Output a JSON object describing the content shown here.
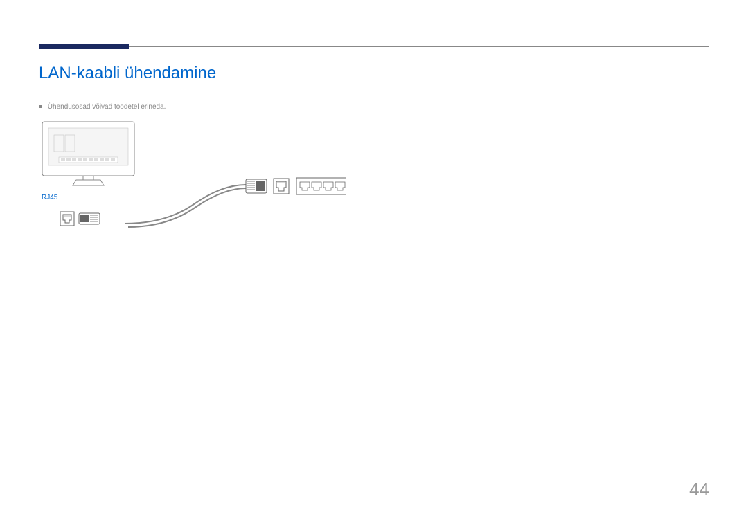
{
  "section": {
    "title": "LAN-kaabli ühendamine"
  },
  "note": {
    "text": "Ühendusosad võivad toodetel erineda."
  },
  "port": {
    "label": "RJ45"
  },
  "page": {
    "number": "44"
  }
}
